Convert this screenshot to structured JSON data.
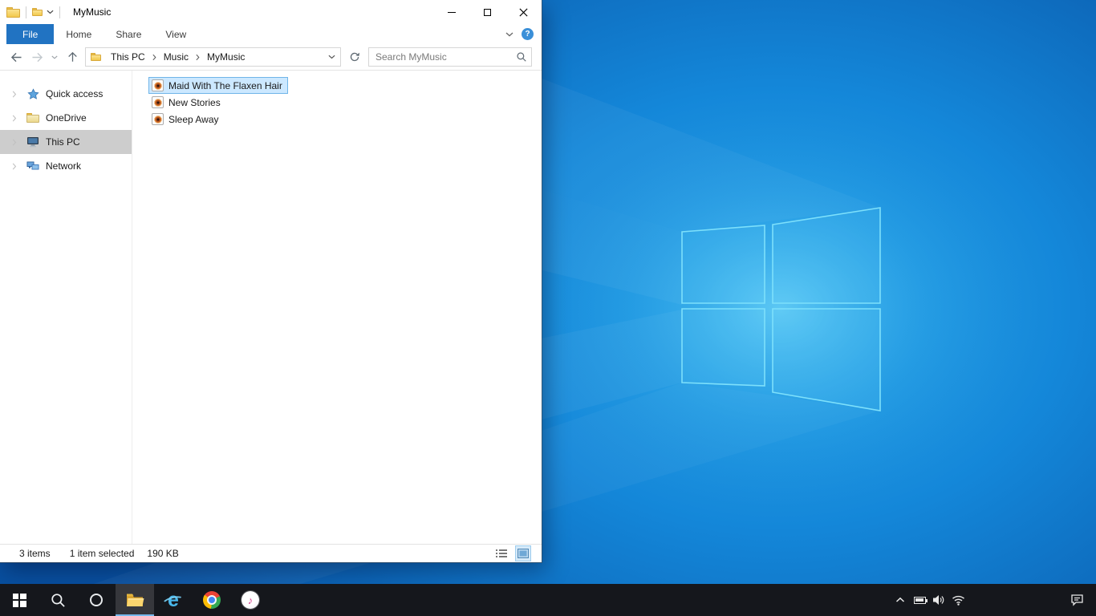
{
  "window": {
    "title": "MyMusic",
    "tabs": [
      {
        "label": "File"
      },
      {
        "label": "Home"
      },
      {
        "label": "Share"
      },
      {
        "label": "View"
      }
    ],
    "help": "?",
    "nav": {
      "breadcrumb": [
        "This PC",
        "Music",
        "MyMusic"
      ],
      "search_placeholder": "Search MyMusic"
    },
    "sidebar": {
      "items": [
        {
          "label": "Quick access"
        },
        {
          "label": "OneDrive"
        },
        {
          "label": "This PC",
          "selected": true
        },
        {
          "label": "Network"
        }
      ]
    },
    "files": {
      "items": [
        {
          "name": "Maid With The Flaxen Hair",
          "selected": true
        },
        {
          "name": "New Stories",
          "selected": false
        },
        {
          "name": "Sleep Away",
          "selected": false
        }
      ]
    },
    "status": {
      "count": "3 items",
      "selection": "1 item selected",
      "size": "190 KB"
    }
  },
  "taskbar": {
    "ie_letter": "e",
    "itunes_note": "♪"
  },
  "colors": {
    "accent": "#0078d7",
    "file_tab_bg": "#2173c2",
    "selection_bg": "#cce8ff",
    "selection_border": "#70b5e8",
    "taskbar_bg": "#15171c",
    "wallpaper_logo": "#7de0fb"
  }
}
